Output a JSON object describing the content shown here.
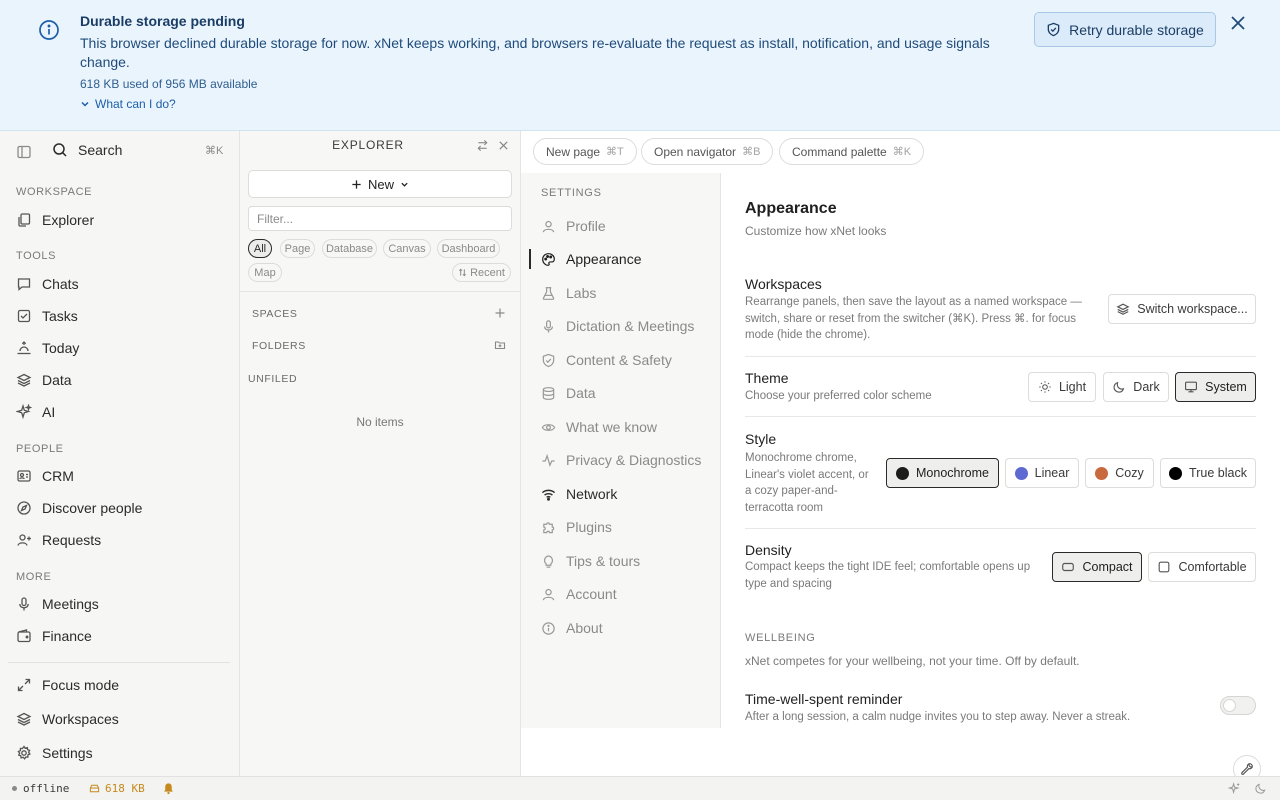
{
  "banner": {
    "title": "Durable storage pending",
    "message": "This browser declined durable storage for now. xNet keeps working, and browsers re-evaluate the request as install, notification, and usage signals change.",
    "usage": "618 KB used of 956 MB available",
    "help_link": "What can I do?",
    "retry_label": "Retry durable storage"
  },
  "sidebar": {
    "search_label": "Search",
    "search_shortcut": "⌘K",
    "sections": {
      "workspace": "WORKSPACE",
      "tools": "TOOLS",
      "people": "PEOPLE",
      "more": "MORE"
    },
    "items": {
      "explorer": "Explorer",
      "chats": "Chats",
      "tasks": "Tasks",
      "today": "Today",
      "data": "Data",
      "ai": "AI",
      "crm": "CRM",
      "discover_people": "Discover people",
      "requests": "Requests",
      "meetings": "Meetings",
      "finance": "Finance",
      "focus_mode": "Focus mode",
      "workspaces": "Workspaces",
      "settings": "Settings"
    }
  },
  "explorer": {
    "title": "EXPLORER",
    "new_label": "New",
    "filter_placeholder": "Filter...",
    "chips": [
      "All",
      "Page",
      "Database",
      "Canvas",
      "Dashboard",
      "Map"
    ],
    "active_chip": "All",
    "sort_label": "Recent",
    "spaces_label": "SPACES",
    "folders_label": "FOLDERS",
    "unfiled_label": "UNFILED",
    "empty_label": "No items"
  },
  "topbar": {
    "new_page": "New page",
    "new_page_kbd": "⌘T",
    "open_navigator": "Open navigator",
    "open_navigator_kbd": "⌘B",
    "command_palette": "Command palette",
    "command_palette_kbd": "⌘K"
  },
  "settings_nav": {
    "heading": "SETTINGS",
    "items": {
      "profile": "Profile",
      "appearance": "Appearance",
      "labs": "Labs",
      "dictation": "Dictation & Meetings",
      "content_safety": "Content & Safety",
      "data": "Data",
      "what_we_know": "What we know",
      "privacy": "Privacy & Diagnostics",
      "network": "Network",
      "plugins": "Plugins",
      "tips": "Tips & tours",
      "account": "Account",
      "about": "About"
    },
    "active": "Appearance"
  },
  "appearance": {
    "title": "Appearance",
    "subtitle": "Customize how xNet looks",
    "workspaces": {
      "title": "Workspaces",
      "desc": "Rearrange panels, then save the layout as a named workspace — switch, share or reset from the switcher (⌘K). Press ⌘. for focus mode (hide the chrome).",
      "button": "Switch workspace..."
    },
    "theme": {
      "title": "Theme",
      "desc": "Choose your preferred color scheme",
      "options": {
        "light": "Light",
        "dark": "Dark",
        "system": "System"
      },
      "selected": "System"
    },
    "style": {
      "title": "Style",
      "desc": "Monochrome chrome, Linear's violet accent, or a cozy paper-and-terracotta room",
      "options": {
        "monochrome": "Monochrome",
        "linear": "Linear",
        "cozy": "Cozy",
        "true_black": "True black"
      },
      "colors": {
        "monochrome": "#1c1c1c",
        "linear": "#5e6ad2",
        "cozy": "#c96a3e",
        "true_black": "#000000"
      },
      "selected": "Monochrome"
    },
    "density": {
      "title": "Density",
      "desc": "Compact keeps the tight IDE feel; comfortable opens up type and spacing",
      "options": {
        "compact": "Compact",
        "comfortable": "Comfortable"
      },
      "selected": "Compact"
    },
    "wellbeing": {
      "heading": "WELLBEING",
      "text": "xNet competes for your wellbeing, not your time. Off by default.",
      "reminder_title": "Time-well-spent reminder",
      "reminder_desc": "After a long session, a calm nudge invites you to step away. Never a streak.",
      "reminder_on": false
    }
  },
  "status": {
    "connection": "offline",
    "storage": "618 KB"
  },
  "colors": {
    "banner_bg": "#eaf4fd",
    "accent_blue": "#1d5fa8",
    "warning": "#c58a1d"
  }
}
